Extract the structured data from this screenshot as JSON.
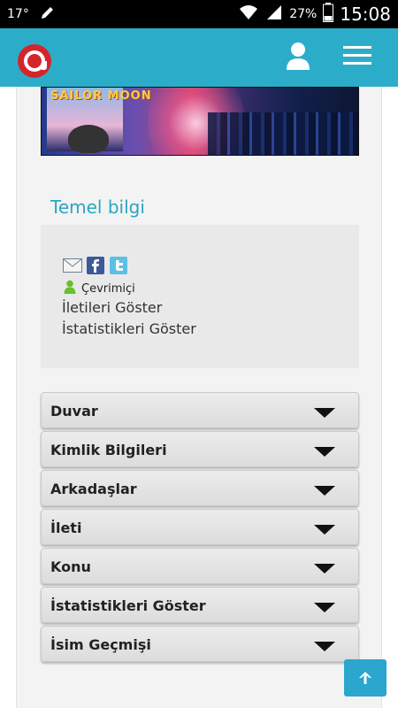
{
  "status": {
    "temperature": "17°",
    "battery": "27%",
    "time": "15:08"
  },
  "header": {
    "logo": "app-logo",
    "user_icon": "user-icon",
    "menu_icon": "hamburger-menu-icon"
  },
  "banner": {
    "poster_text": "SAILOR MOON"
  },
  "profile": {
    "section_title": "Temel bilgi",
    "status_text": "Çevrimiçi",
    "link_posts": "İletileri Göster",
    "link_stats": "İstatistikleri Göster"
  },
  "accordion": [
    {
      "label": "Duvar"
    },
    {
      "label": "Kimlik Bilgileri"
    },
    {
      "label": "Arkadaşlar"
    },
    {
      "label": "İleti"
    },
    {
      "label": "Konu"
    },
    {
      "label": "İstatistikleri Göster"
    },
    {
      "label": "İsim Geçmişi"
    }
  ],
  "colors": {
    "header": "#2badc9",
    "accent": "#2aa6c2",
    "logo": "#d3262b"
  }
}
